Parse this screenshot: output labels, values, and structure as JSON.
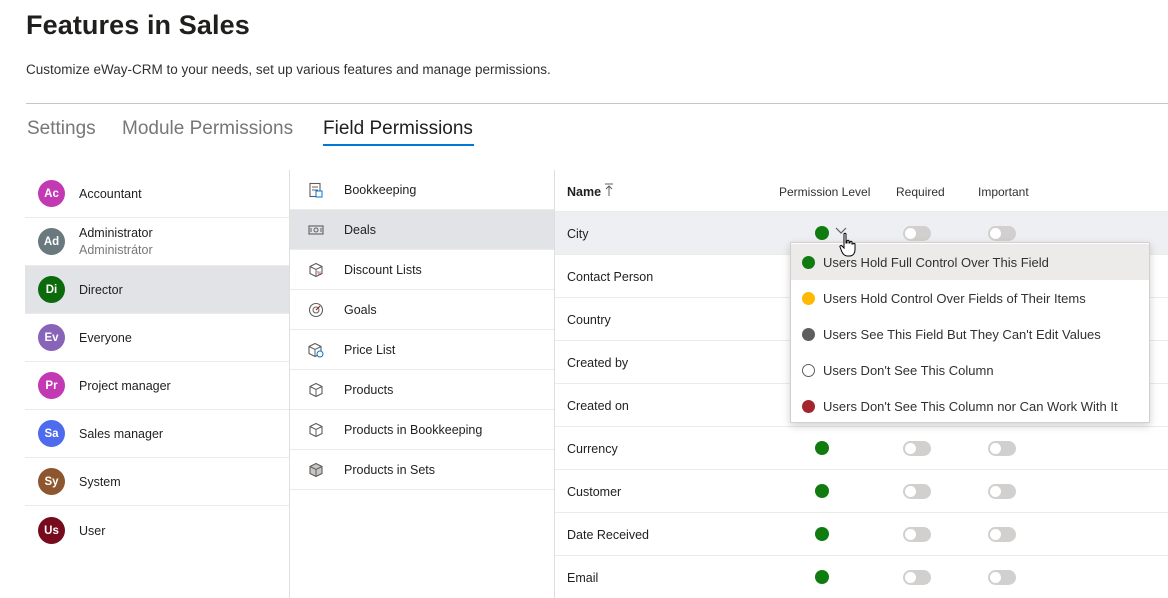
{
  "page": {
    "title": "Features in Sales",
    "subtitle": "Customize eWay-CRM to your needs, set up various features and manage permissions."
  },
  "tabs": [
    {
      "label": "Settings",
      "active": false
    },
    {
      "label": "Module Permissions",
      "active": false
    },
    {
      "label": "Field Permissions",
      "active": true
    }
  ],
  "roles": [
    {
      "initials": "Ac",
      "name": "Accountant",
      "subtitle": "",
      "color": "#c239b3",
      "selected": false
    },
    {
      "initials": "Ad",
      "name": "Administrator",
      "subtitle": "Administrátor",
      "color": "#69797e",
      "selected": false
    },
    {
      "initials": "Di",
      "name": "Director",
      "subtitle": "",
      "color": "#0b6a0b",
      "selected": true
    },
    {
      "initials": "Ev",
      "name": "Everyone",
      "subtitle": "",
      "color": "#8764b8",
      "selected": false
    },
    {
      "initials": "Pr",
      "name": "Project manager",
      "subtitle": "",
      "color": "#c239b3",
      "selected": false
    },
    {
      "initials": "Sa",
      "name": "Sales manager",
      "subtitle": "",
      "color": "#4f6bed",
      "selected": false
    },
    {
      "initials": "Sy",
      "name": "System",
      "subtitle": "",
      "color": "#8e562e",
      "selected": false
    },
    {
      "initials": "Us",
      "name": "User",
      "subtitle": "",
      "color": "#750b1c",
      "selected": false
    }
  ],
  "modules": [
    {
      "label": "Bookkeeping",
      "icon": "bookkeeping-icon",
      "selected": false
    },
    {
      "label": "Deals",
      "icon": "deals-icon",
      "selected": true
    },
    {
      "label": "Discount Lists",
      "icon": "discount-lists-icon",
      "selected": false
    },
    {
      "label": "Goals",
      "icon": "goals-icon",
      "selected": false
    },
    {
      "label": "Price List",
      "icon": "price-list-icon",
      "selected": false
    },
    {
      "label": "Products",
      "icon": "products-icon",
      "selected": false
    },
    {
      "label": "Products in Bookkeeping",
      "icon": "products-in-bookkeeping-icon",
      "selected": false
    },
    {
      "label": "Products in Sets",
      "icon": "products-in-sets-icon",
      "selected": false
    }
  ],
  "grid": {
    "headers": {
      "name": "Name",
      "permission": "Permission Level",
      "required": "Required",
      "important": "Important"
    },
    "rows": [
      {
        "name": "City",
        "dot": "#107c10",
        "open": true
      },
      {
        "name": "Contact Person",
        "dot": "",
        "open": false
      },
      {
        "name": "Country",
        "dot": "",
        "open": false
      },
      {
        "name": "Created by",
        "dot": "",
        "open": false
      },
      {
        "name": "Created on",
        "dot": "",
        "open": false
      },
      {
        "name": "Currency",
        "dot": "#107c10",
        "open": false
      },
      {
        "name": "Customer",
        "dot": "#107c10",
        "open": false
      },
      {
        "name": "Date Received",
        "dot": "#107c10",
        "open": false
      },
      {
        "name": "Email",
        "dot": "#107c10",
        "open": false
      }
    ]
  },
  "dropdown": {
    "options": [
      {
        "label": "Users Hold Full Control Over This Field",
        "color": "#107c10",
        "hollow": false,
        "hover": true
      },
      {
        "label": "Users Hold Control Over Fields of Their Items",
        "color": "#ffb900",
        "hollow": false,
        "hover": false
      },
      {
        "label": "Users See This Field But They Can't Edit Values",
        "color": "#605e5c",
        "hollow": false,
        "hover": false
      },
      {
        "label": "Users Don't See This Column",
        "color": "#ffffff",
        "hollow": true,
        "hover": false
      },
      {
        "label": "Users Don't See This Column nor Can Work With It",
        "color": "#a4262c",
        "hollow": false,
        "hover": false
      }
    ]
  }
}
